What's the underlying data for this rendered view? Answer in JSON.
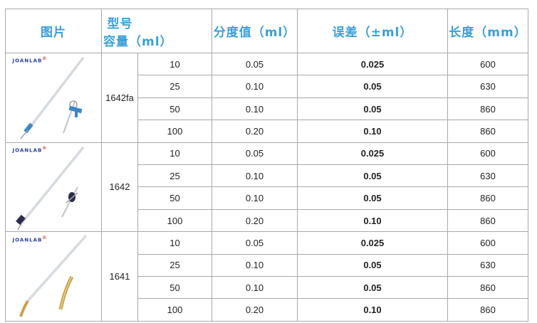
{
  "headers": {
    "picture": "图片",
    "model": "型号",
    "capacity": "容量（ml）",
    "division": "分度值（ml）",
    "tolerance": "误差（±ml）",
    "length": "长度（mm）"
  },
  "brand": {
    "name": "JOANLAB",
    "reg": "®"
  },
  "groups": [
    {
      "model": "1642fa",
      "rows": [
        {
          "capacity": "10",
          "division": "0.05",
          "tolerance": "0.025",
          "length": "600"
        },
        {
          "capacity": "25",
          "division": "0.10",
          "tolerance": "0.05",
          "length": "630"
        },
        {
          "capacity": "50",
          "division": "0.10",
          "tolerance": "0.05",
          "length": "860"
        },
        {
          "capacity": "100",
          "division": "0.20",
          "tolerance": "0.10",
          "length": "860"
        }
      ]
    },
    {
      "model": "1642",
      "rows": [
        {
          "capacity": "10",
          "division": "0.05",
          "tolerance": "0.025",
          "length": "600"
        },
        {
          "capacity": "25",
          "division": "0.10",
          "tolerance": "0.05",
          "length": "630"
        },
        {
          "capacity": "50",
          "division": "0.10",
          "tolerance": "0.05",
          "length": "860"
        },
        {
          "capacity": "100",
          "division": "0.20",
          "tolerance": "0.10",
          "length": "860"
        }
      ]
    },
    {
      "model": "1641",
      "rows": [
        {
          "capacity": "10",
          "division": "0.05",
          "tolerance": "0.025",
          "length": "600"
        },
        {
          "capacity": "25",
          "division": "0.10",
          "tolerance": "0.05",
          "length": "630"
        },
        {
          "capacity": "50",
          "division": "0.10",
          "tolerance": "0.05",
          "length": "860"
        },
        {
          "capacity": "100",
          "division": "0.20",
          "tolerance": "0.10",
          "length": "860"
        }
      ]
    }
  ],
  "colors": {
    "header_text": "#3a9fd9",
    "grid": "#a8a8a8",
    "brand": "#2a3e9c",
    "stopcock_blue": "#3a86c8",
    "stopcock_dark": "#2b2b4a",
    "brass": "#c9a24a"
  }
}
